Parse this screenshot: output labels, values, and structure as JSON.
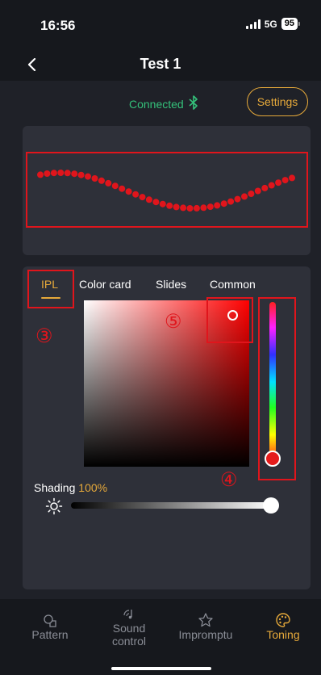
{
  "status_bar": {
    "time": "16:56",
    "network": "5G",
    "battery": "95"
  },
  "nav": {
    "title": "Test 1"
  },
  "connection": {
    "status": "Connected",
    "settings_label": "Settings"
  },
  "preview": {
    "led_color": "#e0151c"
  },
  "tabs": [
    {
      "label": "IPL",
      "active": true
    },
    {
      "label": "Color card",
      "active": false
    },
    {
      "label": "Slides",
      "active": false
    },
    {
      "label": "Common",
      "active": false
    }
  ],
  "markers": {
    "ipl": "③",
    "hue": "④",
    "picker": "⑤"
  },
  "picker": {
    "hue_color": "#ff0000"
  },
  "shading": {
    "label": "Shading",
    "value": "100%",
    "level": 1.0
  },
  "bottom_nav": [
    {
      "label": "Pattern",
      "icon": "pattern-icon",
      "active": false
    },
    {
      "label": "Sound control",
      "icon": "sound-icon",
      "active": false
    },
    {
      "label": "Impromptu",
      "icon": "impromptu-icon",
      "active": false
    },
    {
      "label": "Toning",
      "icon": "palette-icon",
      "active": true
    }
  ],
  "colors": {
    "accent": "#e6a93a",
    "connected": "#34c17a",
    "annotation": "#e0151c"
  }
}
